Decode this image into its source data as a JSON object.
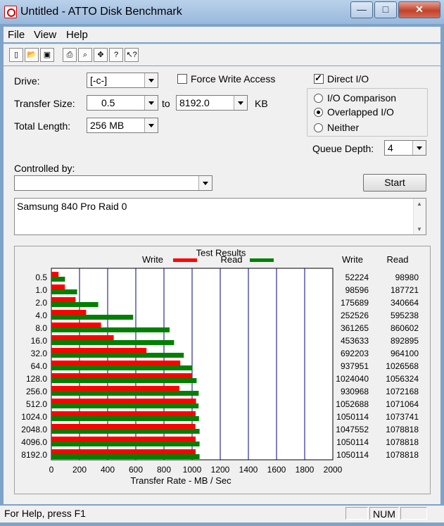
{
  "window": {
    "title": "Untitled - ATTO Disk Benchmark",
    "minimize": "—",
    "maximize": "□",
    "close": "✕"
  },
  "menu": [
    "File",
    "View",
    "Help"
  ],
  "toolbar": [
    "new-icon",
    "open-icon",
    "save-icon",
    "print-icon",
    "print-preview-icon",
    "move-icon",
    "help-icon",
    "context-help-icon"
  ],
  "form": {
    "drive_label": "Drive:",
    "drive_value": "[-c-]",
    "force_write_label": "Force Write Access",
    "force_write_checked": false,
    "direct_io_label": "Direct I/O",
    "direct_io_checked": true,
    "transfer_size_label": "Transfer Size:",
    "transfer_from": "0.5",
    "to_label": "to",
    "transfer_to": "8192.0",
    "kb_label": "KB",
    "total_length_label": "Total Length:",
    "total_length_value": "256 MB",
    "io_comparison_label": "I/O Comparison",
    "overlapped_io_label": "Overlapped I/O",
    "neither_label": "Neither",
    "selected_mode": "Overlapped I/O",
    "queue_depth_label": "Queue Depth:",
    "queue_depth_value": "4",
    "controlled_by_label": "Controlled by:",
    "controlled_by_value": "",
    "start_label": "Start",
    "description": "Samsung 840 Pro Raid 0"
  },
  "results": {
    "title": "Test Results",
    "legend_write": "Write",
    "legend_read": "Read",
    "col_write": "Write",
    "col_read": "Read",
    "write_color": "#ff0000",
    "read_color": "#008000",
    "grid_color": "#000080"
  },
  "chart_data": {
    "type": "bar",
    "orientation": "horizontal",
    "title": "Test Results",
    "xlabel": "Transfer Rate - MB / Sec",
    "xlim": [
      0,
      2000
    ],
    "xticks": [
      "0",
      "200",
      "400",
      "600",
      "800",
      "1000",
      "1200",
      "1400",
      "1600",
      "1800",
      "2000"
    ],
    "categories": [
      "0.5",
      "1.0",
      "2.0",
      "4.0",
      "8.0",
      "16.0",
      "32.0",
      "64.0",
      "128.0",
      "256.0",
      "512.0",
      "1024.0",
      "2048.0",
      "4096.0",
      "8192.0"
    ],
    "series": [
      {
        "name": "Write",
        "values": [
          51,
          96,
          172,
          247,
          353,
          443,
          676,
          916,
          1000,
          909,
          1028,
          1025,
          1023,
          1025,
          1025
        ]
      },
      {
        "name": "Read",
        "values": [
          97,
          183,
          333,
          581,
          840,
          872,
          941,
          1003,
          1032,
          1047,
          1046,
          1049,
          1053,
          1053,
          1053
        ]
      }
    ],
    "write_table": [
      "52224",
      "98596",
      "175689",
      "252526",
      "361265",
      "453633",
      "692203",
      "937951",
      "1024040",
      "930968",
      "1052688",
      "1050114",
      "1047552",
      "1050114",
      "1050114"
    ],
    "read_table": [
      "98980",
      "187721",
      "340664",
      "595238",
      "860602",
      "892895",
      "964100",
      "1026568",
      "1056324",
      "1072168",
      "1071064",
      "1073741",
      "1078818",
      "1078818",
      "1078818"
    ],
    "legend_placement": "top",
    "grid": true
  },
  "status": {
    "help_text": "For Help, press F1",
    "num": "NUM"
  }
}
